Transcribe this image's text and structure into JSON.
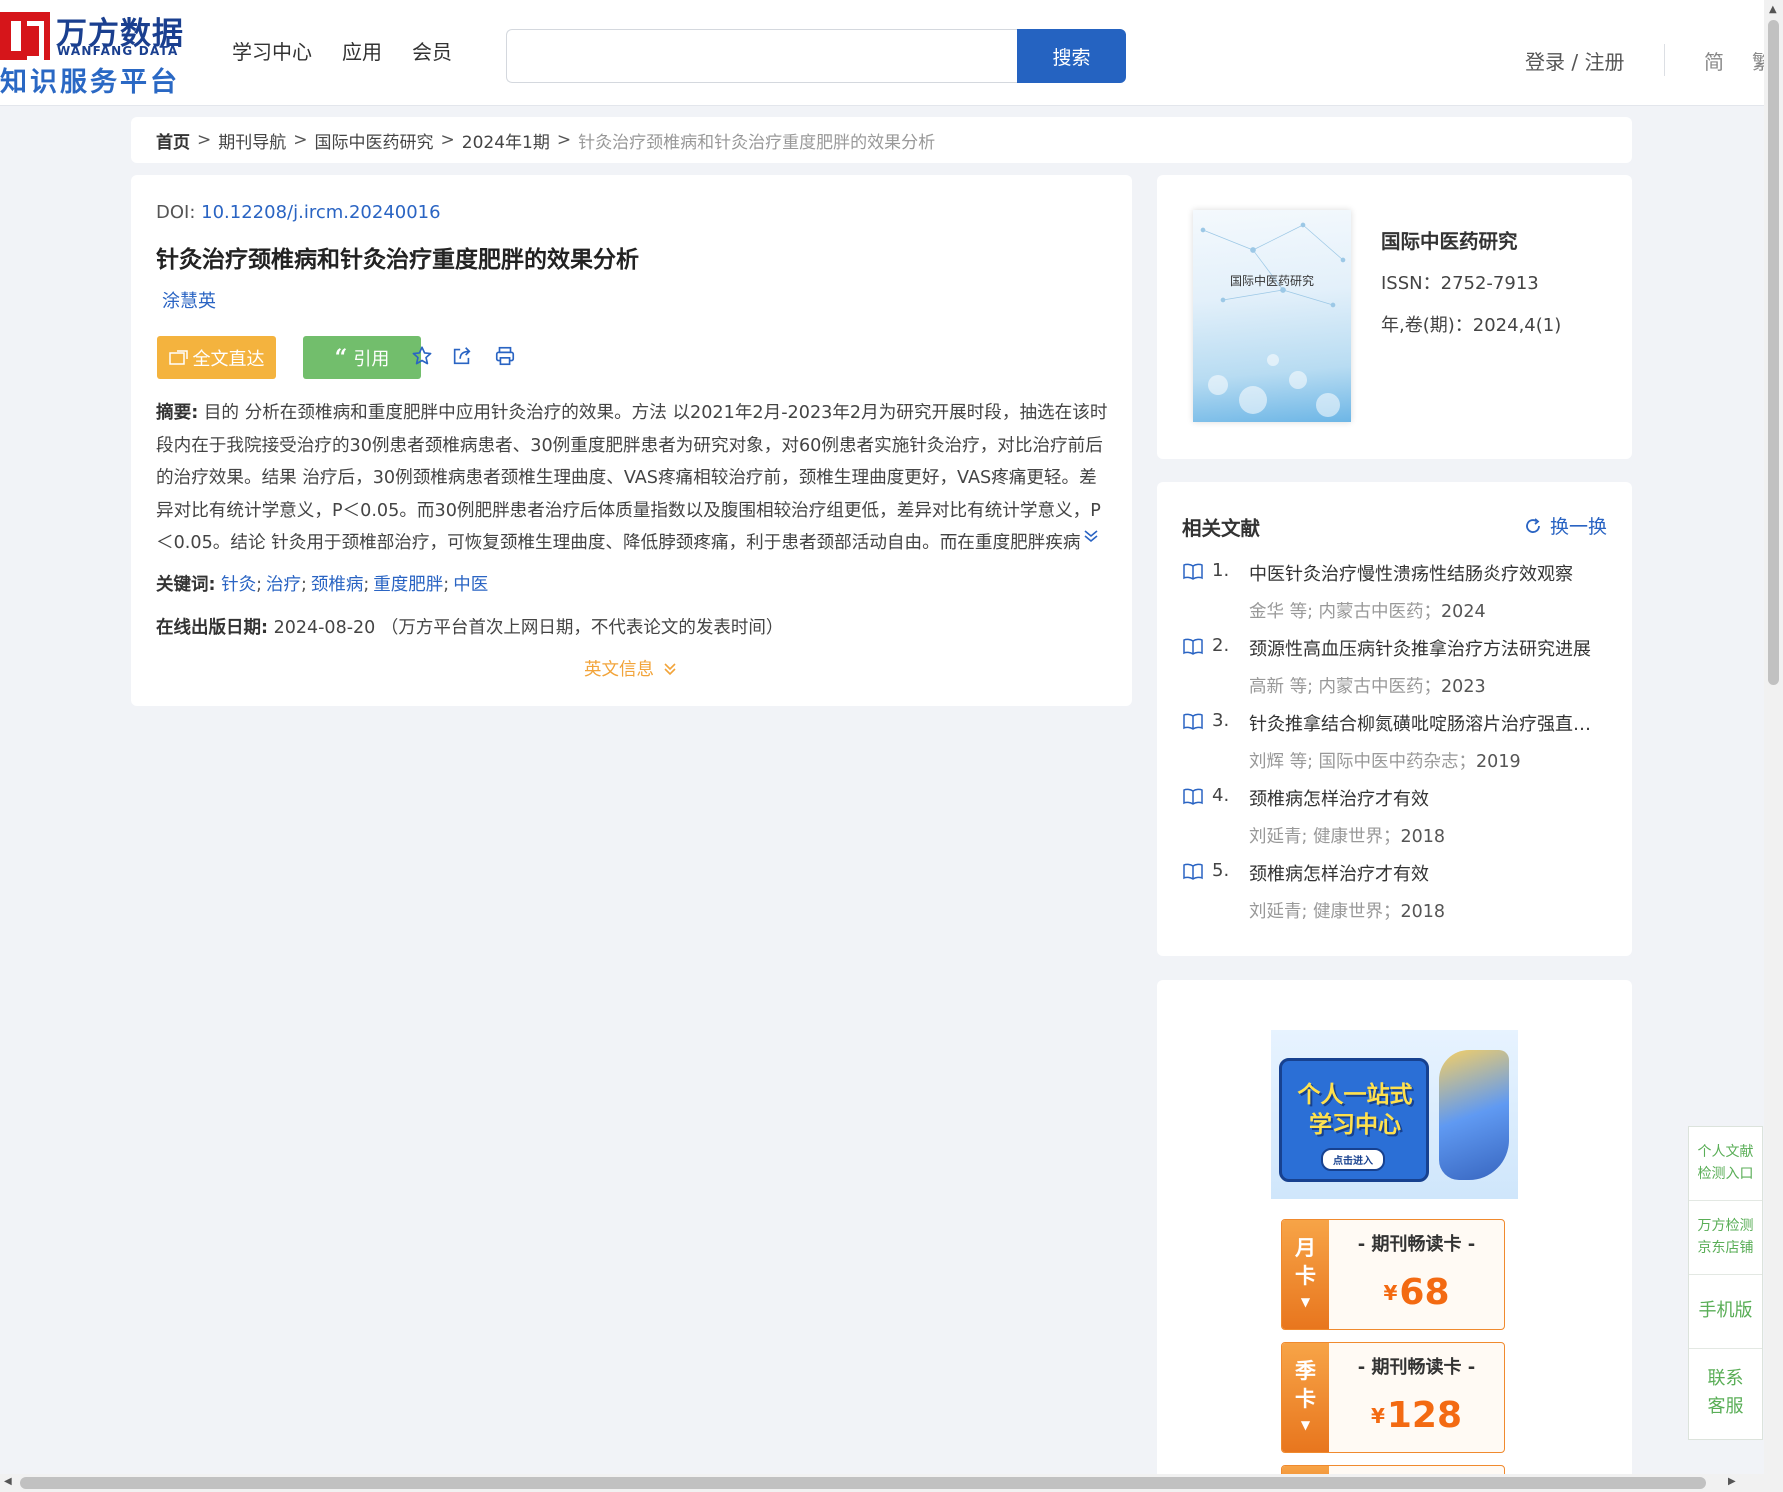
{
  "header": {
    "logo_cn": "万方数据",
    "logo_en": "WANFANG DATA",
    "logo_sub": "知识服务平台",
    "nav": [
      "学习中心",
      "应用",
      "会员"
    ],
    "search_value": "",
    "search_button": "搜索",
    "login": "登录 / 注册",
    "lang_simplified": "简",
    "lang_traditional": "繁"
  },
  "breadcrumb": {
    "home": "首页",
    "items": [
      "期刊导航",
      "国际中医药研究",
      "2024年1期"
    ],
    "current": "针灸治疗颈椎病和针灸治疗重度肥胖的效果分析",
    "sep": ">"
  },
  "article": {
    "doi_label": "DOI:",
    "doi": "10.12208/j.ircm.20240016",
    "title": "针灸治疗颈椎病和针灸治疗重度肥胖的效果分析",
    "author": "涂慧英",
    "btn_fulltext": "全文直达",
    "btn_cite": "引用",
    "cite_mark": "“",
    "abstract_label": "摘要:",
    "abstract": "目的 分析在颈椎病和重度肥胖中应用针灸治疗的效果。方法 以2021年2月-2023年2月为研究开展时段，抽选在该时段内在于我院接受治疗的30例患者颈椎病患者、30例重度肥胖患者为研究对象，对60例患者实施针灸治疗，对比治疗前后的治疗效果。结果 治疗后，30例颈椎病患者颈椎生理曲度、VAS疼痛相较治疗前，颈椎生理曲度更好，VAS疼痛更轻。差异对比有统计学意义，P＜0.05。而30例肥胖患者治疗后体质量指数以及腹围相较治疗组更低，差异对比有统计学意义，P＜0.05。结论 针灸用于颈椎部治疗，可恢复颈椎生理曲度、降低脖颈疼痛，利于患者颈部活动自由。而在重度肥胖疾病上...",
    "keywords_label": "关键词:",
    "keywords": [
      "针灸",
      "治疗",
      "颈椎病",
      "重度肥胖",
      "中医"
    ],
    "pubdate_label": "在线出版日期:",
    "pubdate": "2024-08-20",
    "pubdate_note": "（万方平台首次上网日期，不代表论文的发表时间）",
    "en_info": "英文信息"
  },
  "journal": {
    "cover_title": "国际中医药研究",
    "name": "国际中医药研究",
    "issn": "ISSN：2752-7913",
    "volume": "年,卷(期)：2024,4(1)"
  },
  "related": {
    "heading": "相关文献",
    "refresh": "换一换",
    "items": [
      {
        "num": "1.",
        "title": "中医针灸治疗慢性溃疡性结肠炎疗效观察",
        "authors": "金华 等;",
        "source": "内蒙古中医药；",
        "year": "2024"
      },
      {
        "num": "2.",
        "title": "颈源性高血压病针灸推拿治疗方法研究进展",
        "authors": "高新 等;",
        "source": "内蒙古中医药；",
        "year": "2023"
      },
      {
        "num": "3.",
        "title": "针灸推拿结合柳氮磺吡啶肠溶片治疗强直性...",
        "authors": "刘辉 等;",
        "source": "国际中医中药杂志；",
        "year": "2019"
      },
      {
        "num": "4.",
        "title": "颈椎病怎样治疗才有效",
        "authors": "刘延青;",
        "source": "健康世界；",
        "year": "2018"
      },
      {
        "num": "5.",
        "title": "颈椎病怎样治疗才有效",
        "authors": "刘延青;",
        "source": "健康世界；",
        "year": "2018"
      }
    ]
  },
  "promo": {
    "banner_line1": "个人一站式",
    "banner_line2": "学习中心",
    "banner_button": "点击进入",
    "cards": [
      {
        "side": "月卡",
        "name": "- 期刊畅读卡 -",
        "currency": "¥",
        "price": "68"
      },
      {
        "side": "季卡",
        "name": "- 期刊畅读卡 -",
        "currency": "¥",
        "price": "128"
      }
    ]
  },
  "float_panel": {
    "items": [
      "个人文献检测入口",
      "万方检测京东店铺",
      "手机版",
      "联系客服"
    ]
  },
  "colors": {
    "primary_blue": "#2563c1",
    "link_blue": "#2a64c3",
    "orange": "#f4b33e",
    "green": "#72be6c",
    "price_orange": "#f36a12"
  }
}
